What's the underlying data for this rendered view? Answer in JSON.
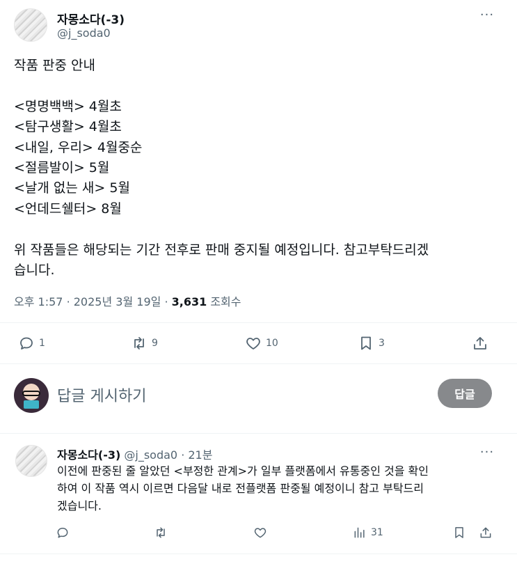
{
  "tweet": {
    "author_name": "자몽소다(-3)",
    "author_handle": "@j_soda0",
    "more": "···",
    "lines": [
      "작품 판중 안내",
      "",
      "<명명백백> 4월초",
      "<탐구생활> 4월초",
      "<내일, 우리> 4월중순",
      "<절름발이> 5월",
      "<날개 없는 새> 5월",
      "<언데드쉘터> 8월",
      "",
      "위 작품들은 해당되는 기간 전후로 판매 중지될 예정입니다. 참고부탁드리겠",
      "습니다."
    ],
    "time": "오후 1:57",
    "date": "2025년 3월 19일",
    "sep": "·",
    "views": "3,631",
    "views_label": "조회수",
    "actions": {
      "replies": "1",
      "retweets": "9",
      "likes": "10",
      "bookmarks": "3"
    }
  },
  "reply_box": {
    "placeholder": "답글 게시하기",
    "button": "답글"
  },
  "reply": {
    "author_name": "자몽소다(-3)",
    "author_handle": "@j_soda0",
    "time": "· 21분",
    "more": "···",
    "lines": [
      "이전에 판중된 줄 알았던 <부정한 관계>가 일부 플랫폼에서 유통중인 것을 확인",
      "하여 이 작품 역시 이르면 다음달 내로 전플랫폼 판중될 예정이니 참고 부탁드리",
      "겠습니다."
    ],
    "views": "31"
  },
  "icons": {
    "reply": "reply-icon",
    "retweet": "retweet-icon",
    "like": "heart-icon",
    "bookmark": "bookmark-icon",
    "share": "share-icon",
    "views": "views-icon"
  }
}
